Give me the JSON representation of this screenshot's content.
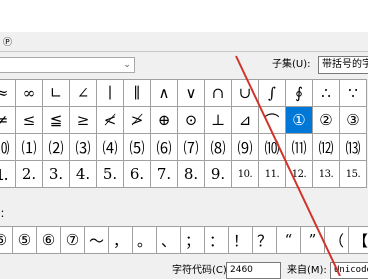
{
  "window": {
    "menu_tab": "Ⓟ"
  },
  "font_select": {
    "value": ""
  },
  "subset": {
    "label": "子集(U):",
    "value": "带括号的字"
  },
  "grid": {
    "rows": [
      [
        "≈",
        "∞",
        "∟",
        "∠",
        "∣",
        "∥",
        "∧",
        "∨",
        "∩",
        "∪",
        "∫",
        "∮",
        "∴",
        "∵"
      ],
      [
        "≠",
        "≤",
        "≦",
        "≥",
        "≮",
        "≯",
        "⊕",
        "⊙",
        "⊥",
        "⊿",
        "⌒",
        "①",
        "②",
        "③"
      ],
      [
        "⑽",
        "⑴",
        "⑵",
        "⑶",
        "⑷",
        "⑸",
        "⑹",
        "⑺",
        "⑻",
        "⑼",
        "⑽",
        "⑾",
        "⑿",
        "⒀"
      ],
      [
        "⒈",
        "2.",
        "3.",
        "4.",
        "5.",
        "6.",
        "7.",
        "8.",
        "9.",
        "10.",
        "11.",
        "12.",
        "13.",
        "15."
      ]
    ],
    "selected": "①"
  },
  "recent": {
    "label": "：",
    "chars": [
      "⑤",
      "⑤",
      "⑥",
      "⑦",
      "～",
      "，",
      "。",
      "、",
      "；",
      "：",
      "！",
      "？",
      "“",
      "”",
      "（",
      "【"
    ]
  },
  "char_code": {
    "label": "字符代码(C):",
    "value": "2460"
  },
  "from": {
    "label": "来自(M):",
    "value": "Unicode(十"
  },
  "colors": {
    "selected_bg": "#0078d7",
    "annotation": "#d0342c"
  }
}
